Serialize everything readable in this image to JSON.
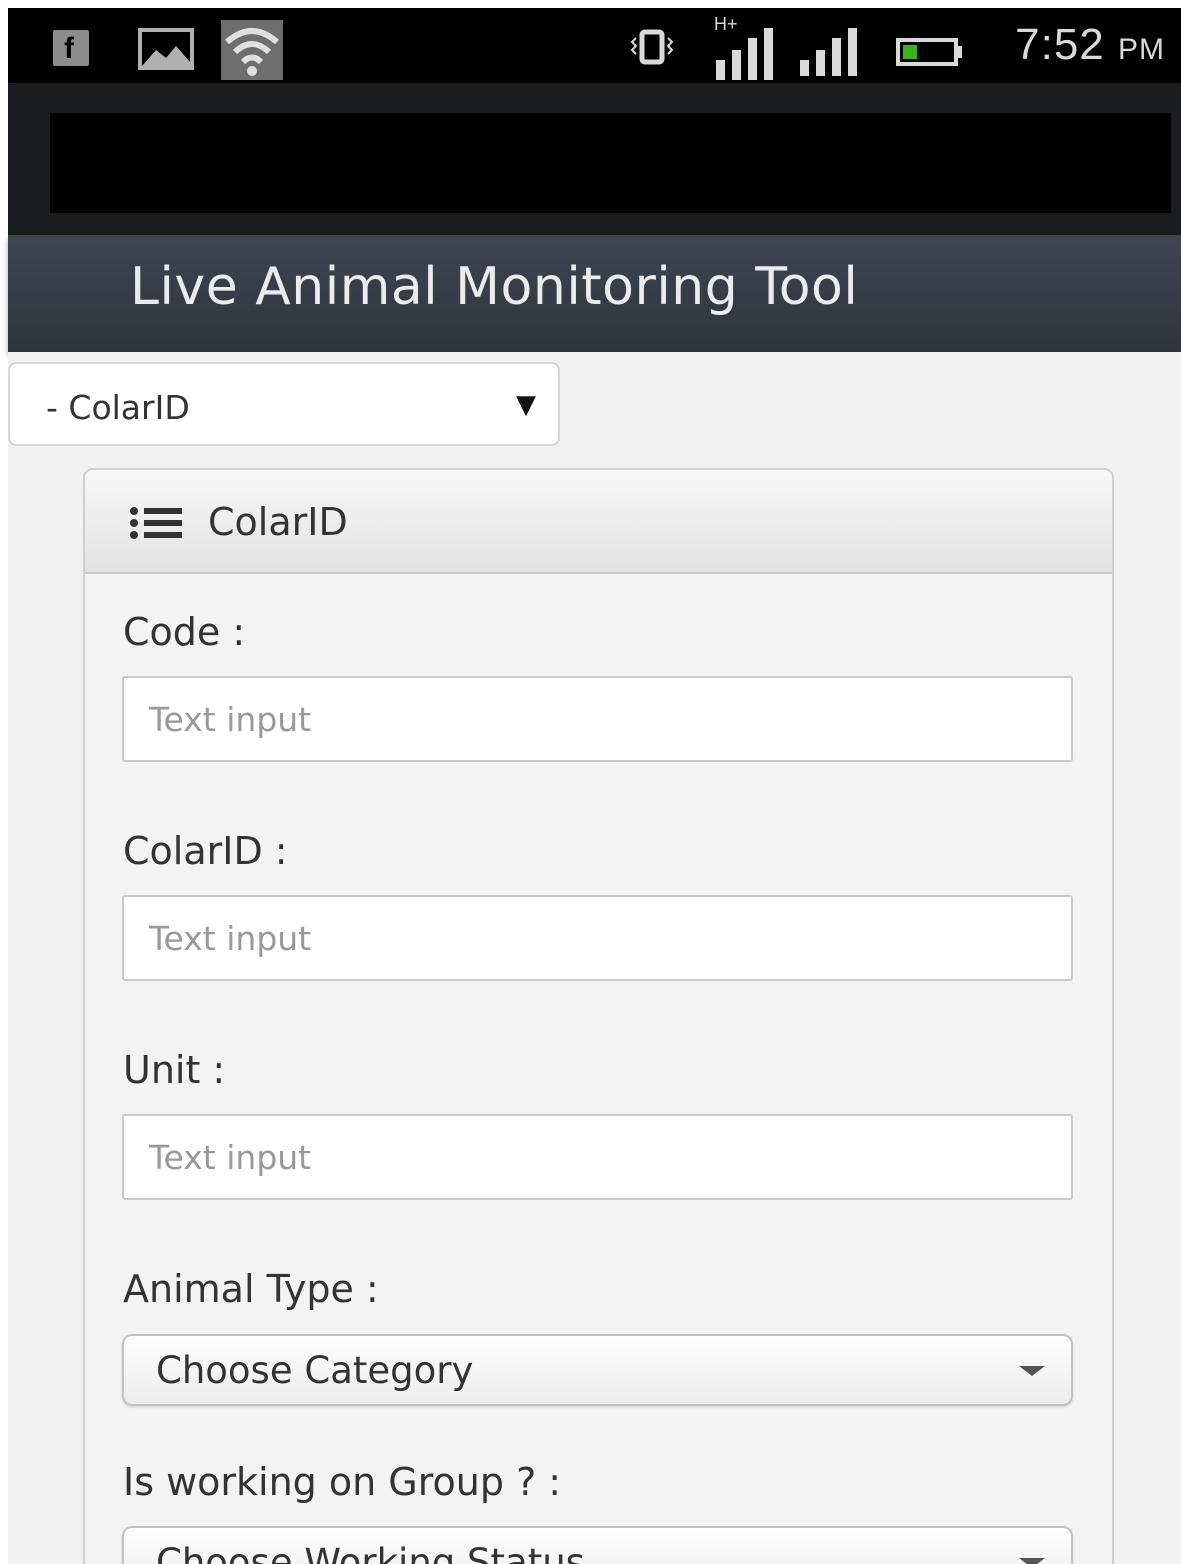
{
  "status_bar": {
    "time": "7:52",
    "ampm": "PM",
    "network_label": "H+",
    "icons": [
      "facebook-icon",
      "photo-icon",
      "wifi-icon",
      "vibrate-icon",
      "signal-icon",
      "signal-icon",
      "battery-icon"
    ]
  },
  "app": {
    "title": "Live Animal Monitoring Tool"
  },
  "top_select": {
    "value": "- ColarID"
  },
  "panel": {
    "title": "ColarID",
    "fields": [
      {
        "label": "Code :",
        "placeholder": "Text input"
      },
      {
        "label": "ColarID :",
        "placeholder": "Text input"
      },
      {
        "label": "Unit :",
        "placeholder": "Text input"
      }
    ],
    "animal_type": {
      "label": "Animal Type :",
      "value": "Choose Category"
    },
    "working_group": {
      "label": "Is working on Group ? :",
      "value": "Choose Working Status"
    }
  },
  "colors": {
    "header_bg": "#3a3f4a",
    "content_bg": "#f1f1f1",
    "status_bar_bg": "#000000",
    "battery_fill": "#3cb01e"
  }
}
